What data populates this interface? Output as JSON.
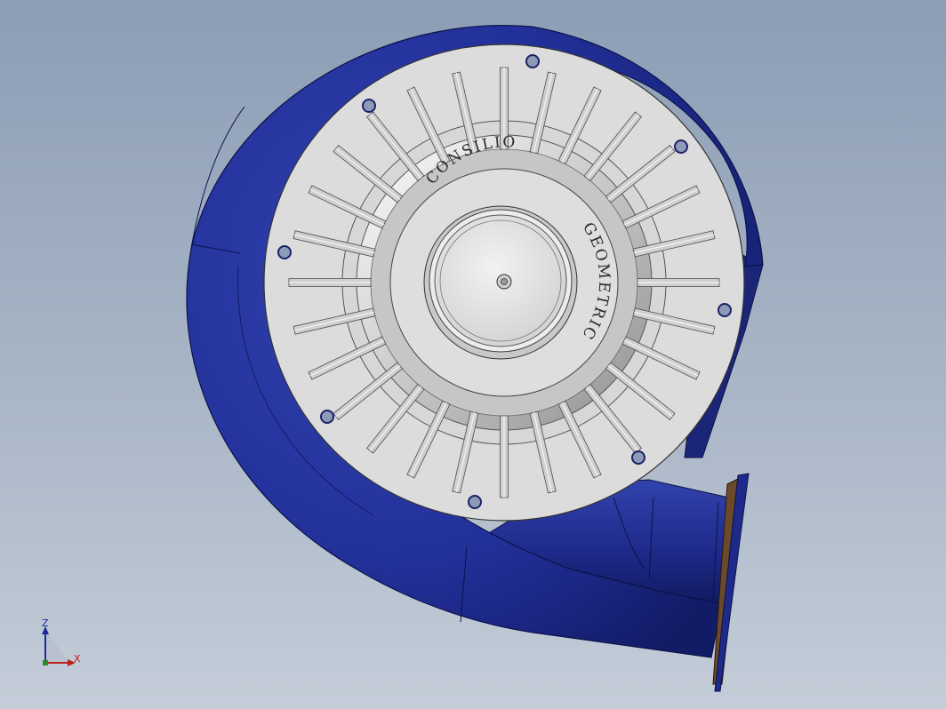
{
  "model": {
    "label_top": "CONSILIO",
    "label_side": "GEOMETRIC"
  },
  "triad": {
    "z_label": "Z",
    "x_label": "X"
  },
  "colors": {
    "housing": "#1e2a8a",
    "cover": "#dcdcdc",
    "flange": "#6b4a2b"
  }
}
